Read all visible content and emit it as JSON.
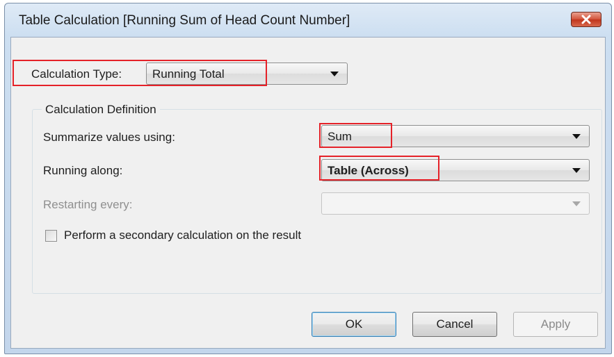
{
  "dialog": {
    "title": "Table Calculation [Running Sum of Head Count Number]"
  },
  "calculation_type": {
    "label": "Calculation Type:",
    "value": "Running Total"
  },
  "definition": {
    "group_label": "Calculation Definition",
    "summarize": {
      "label": "Summarize values using:",
      "value": "Sum"
    },
    "running_along": {
      "label": "Running along:",
      "value": "Table (Across)"
    },
    "restarting": {
      "label": "Restarting every:",
      "value": ""
    },
    "secondary": {
      "label": "Perform a secondary calculation on the result",
      "checked": false
    }
  },
  "buttons": {
    "ok": "OK",
    "cancel": "Cancel",
    "apply": "Apply"
  },
  "colors": {
    "highlight_box": "#e52128",
    "close_button": "#c7432a"
  }
}
